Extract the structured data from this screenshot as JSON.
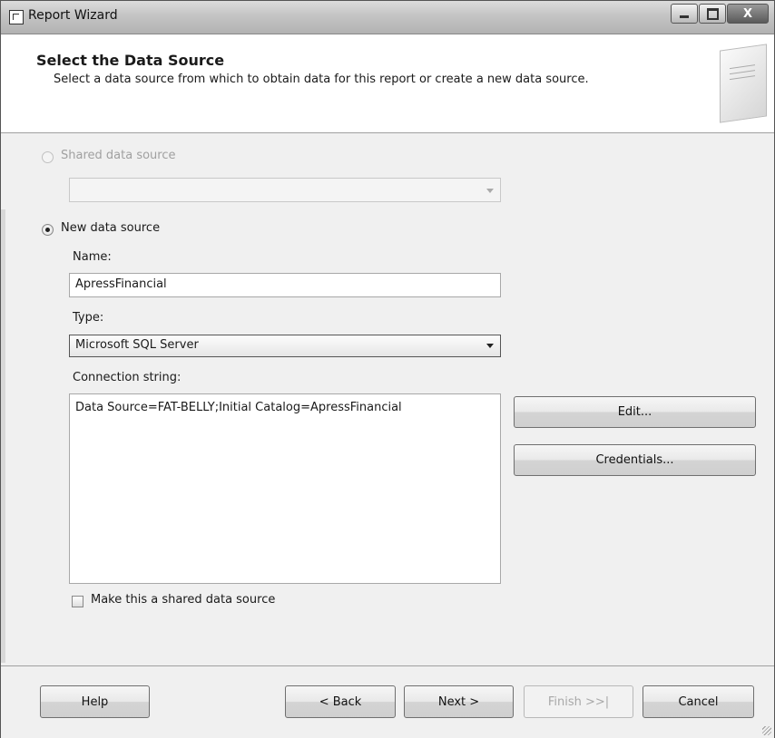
{
  "window": {
    "title": "Report Wizard",
    "icon": "report-wizard-icon",
    "controls": [
      "minimize-icon",
      "maximize-icon",
      "close-icon"
    ],
    "close_glyph": "X"
  },
  "header": {
    "title": "Select the Data Source",
    "subtitle": "Select a data source from which to obtain data for this report or create a new data source."
  },
  "form": {
    "shared_source_label": "Shared data source",
    "shared_source_value": "",
    "new_source_label": "New data source",
    "selected_option": "New data source",
    "name_label": "Name:",
    "name_value": "ApressFinancial",
    "type_label": "Type:",
    "type_value": "Microsoft SQL Server",
    "connection_label": "Connection string:",
    "connection_value": "Data Source=FAT-BELLY;Initial Catalog=ApressFinancial",
    "edit_button": "Edit...",
    "credentials_button": "Credentials...",
    "shared_checkbox_label": "Make this a shared data source",
    "shared_checkbox_checked": false
  },
  "footer": {
    "help": "Help",
    "back": "< Back",
    "next": "Next >",
    "finish": "Finish >>|",
    "cancel": "Cancel"
  }
}
